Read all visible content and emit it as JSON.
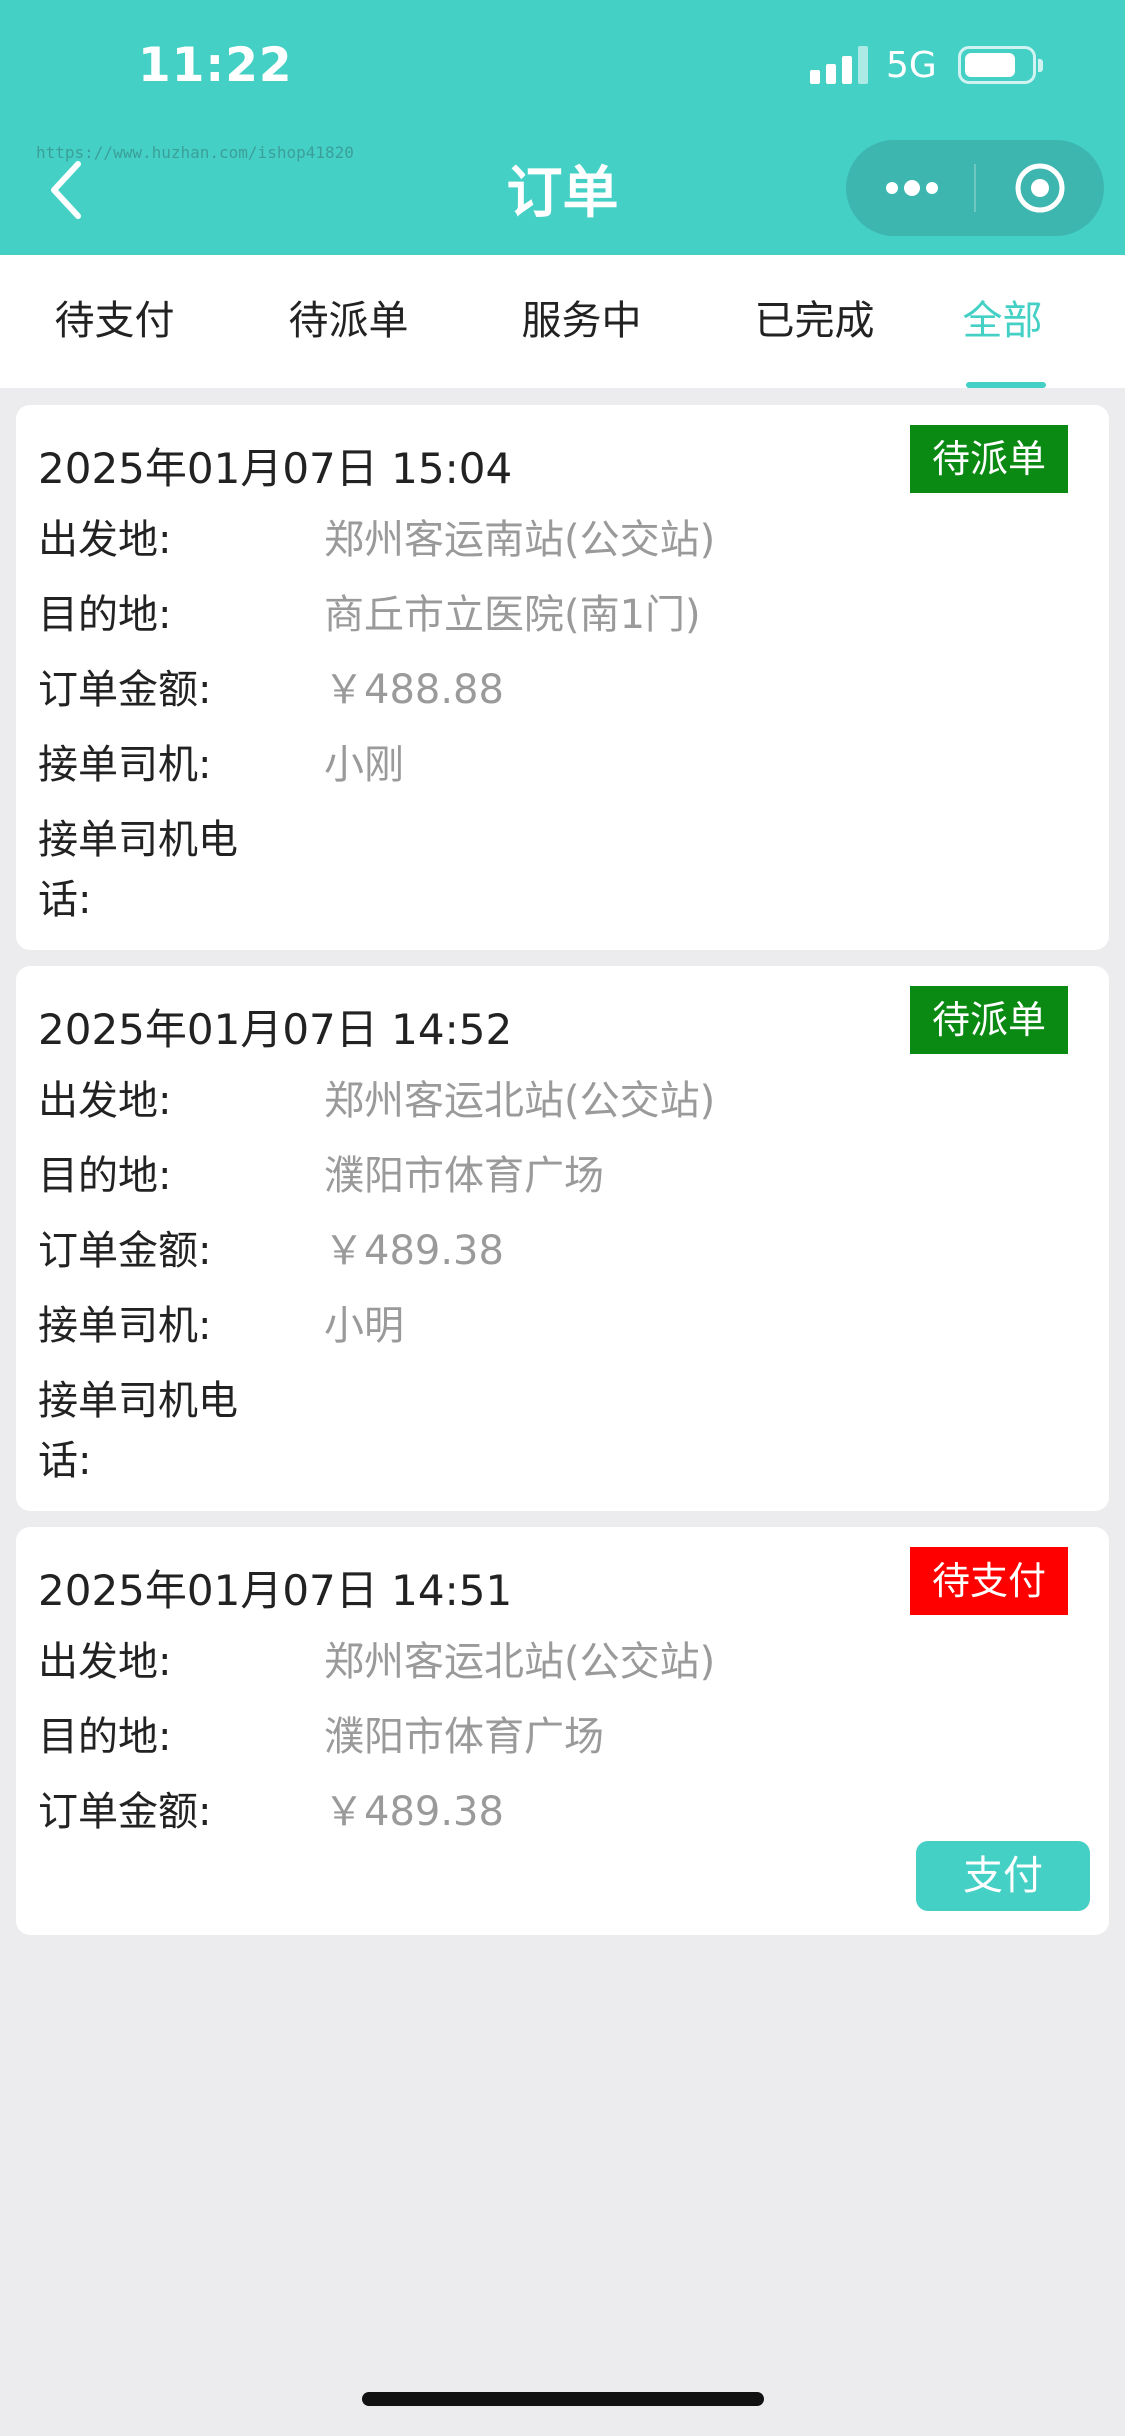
{
  "status_bar": {
    "time": "11:22",
    "network": "5G"
  },
  "header": {
    "title": "订单",
    "watermark": "https://www.huzhan.com/ishop41820"
  },
  "tabs": [
    {
      "label": "待支付",
      "active": false
    },
    {
      "label": "待派单",
      "active": false
    },
    {
      "label": "服务中",
      "active": false
    },
    {
      "label": "已完成",
      "active": false
    },
    {
      "label": "全部",
      "active": true
    }
  ],
  "colors": {
    "accent": "#45d0c6",
    "status_green": "#0a8a12",
    "status_red": "#ff0000"
  },
  "orders": [
    {
      "date": "2025年01月07日 15:04",
      "status": "待派单",
      "from_label": "出发地:",
      "from": "郑州客运南站(公交站)",
      "to_label": "目的地:",
      "to": "商丘市立医院(南1门)",
      "amount_label": "订单金额:",
      "amount": "￥488.88",
      "driver_label": "接单司机:",
      "driver": "小刚",
      "phone_label": "接单司机电话:"
    },
    {
      "date": "2025年01月07日 14:52",
      "status": "待派单",
      "from_label": "出发地:",
      "from": "郑州客运北站(公交站)",
      "to_label": "目的地:",
      "to": "濮阳市体育广场",
      "amount_label": "订单金额:",
      "amount": "￥489.38",
      "driver_label": "接单司机:",
      "driver": "小明",
      "phone_label": "接单司机电话:"
    },
    {
      "date": "2025年01月07日 14:51",
      "status": "待支付",
      "from_label": "出发地:",
      "from": "郑州客运北站(公交站)",
      "to_label": "目的地:",
      "to": "濮阳市体育广场",
      "amount_label": "订单金额:",
      "amount": "￥489.38",
      "pay_button": "支付"
    }
  ]
}
